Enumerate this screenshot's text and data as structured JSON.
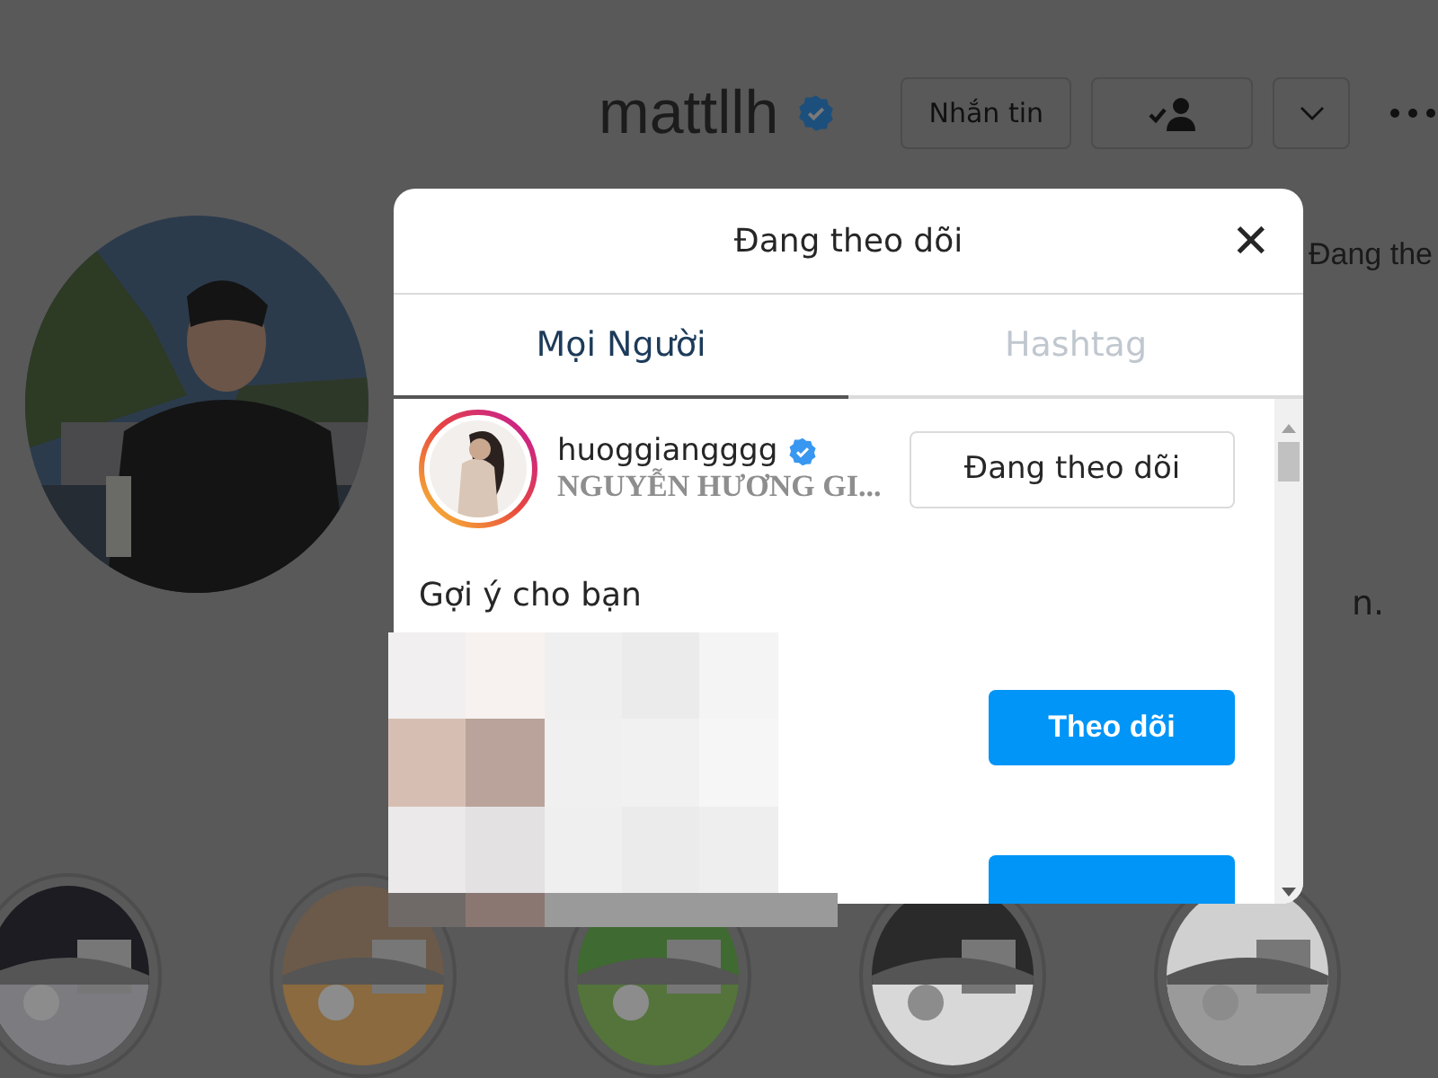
{
  "profile": {
    "username": "mattllh",
    "verified": true,
    "message_button": "Nhắn tin",
    "partial_texts": [
      "Đang the",
      "n."
    ]
  },
  "dialog": {
    "title": "Đang theo dõi",
    "close": "✕",
    "tabs": [
      {
        "label": "Mọi Người",
        "selected": true
      },
      {
        "label": "Hashtag",
        "selected": false
      }
    ],
    "following": [
      {
        "username": "huoggiangggg",
        "verified": true,
        "full_name": "NGUYỄN HƯƠNG GI...",
        "button": "Đang theo dõi"
      }
    ],
    "suggestions_heading": "Gợi ý cho bạn",
    "suggestions": [
      {
        "kind": "follow",
        "button": "Theo dõi"
      },
      {
        "kind": "cut"
      }
    ]
  }
}
